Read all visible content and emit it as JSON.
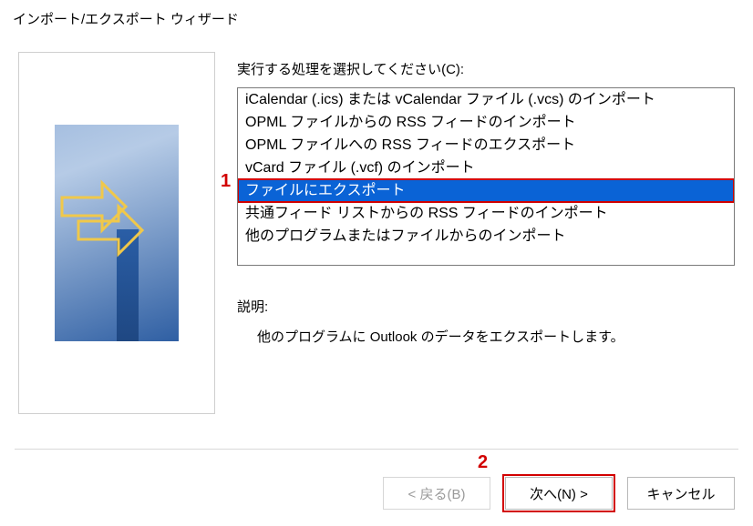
{
  "title": "インポート/エクスポート ウィザード",
  "instruction": "実行する処理を選択してください(C):",
  "list": {
    "items": [
      "iCalendar (.ics) または vCalendar ファイル (.vcs) のインポート",
      "OPML ファイルからの RSS フィードのインポート",
      "OPML ファイルへの RSS フィードのエクスポート",
      "vCard ファイル (.vcf) のインポート",
      "ファイルにエクスポート",
      "共通フィード リストからの RSS フィードのインポート",
      "他のプログラムまたはファイルからのインポート"
    ],
    "selected_index": 4
  },
  "description_label": "説明:",
  "description_text": "他のプログラムに Outlook のデータをエクスポートします。",
  "buttons": {
    "back": "< 戻る(B)",
    "next": "次へ(N) >",
    "cancel": "キャンセル"
  },
  "callouts": {
    "one": "1",
    "two": "2"
  }
}
